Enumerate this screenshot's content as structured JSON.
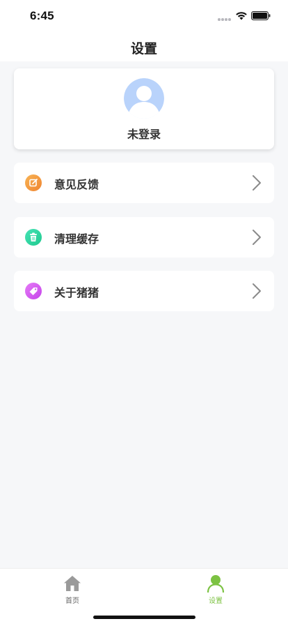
{
  "status_bar": {
    "time": "6:45"
  },
  "header": {
    "title": "设置"
  },
  "profile": {
    "status": "未登录",
    "avatar_color": "#b9d3fb"
  },
  "menu": [
    {
      "label": "意见反馈",
      "icon": "feedback-icon",
      "color": "#f49a3d"
    },
    {
      "label": "清理缓存",
      "icon": "trash-icon",
      "color": "#2fd8a4"
    },
    {
      "label": "关于猪猪",
      "icon": "tag-icon",
      "color": "#d35af0"
    }
  ],
  "tab_bar": {
    "tabs": [
      {
        "label": "首页",
        "icon": "home-icon",
        "active": false,
        "color": "#9a9a9a"
      },
      {
        "label": "设置",
        "icon": "user-icon",
        "active": true,
        "color": "#7cc242"
      }
    ]
  },
  "colors": {
    "background": "#f6f7f9",
    "card": "#ffffff",
    "accent": "#7cc242"
  }
}
